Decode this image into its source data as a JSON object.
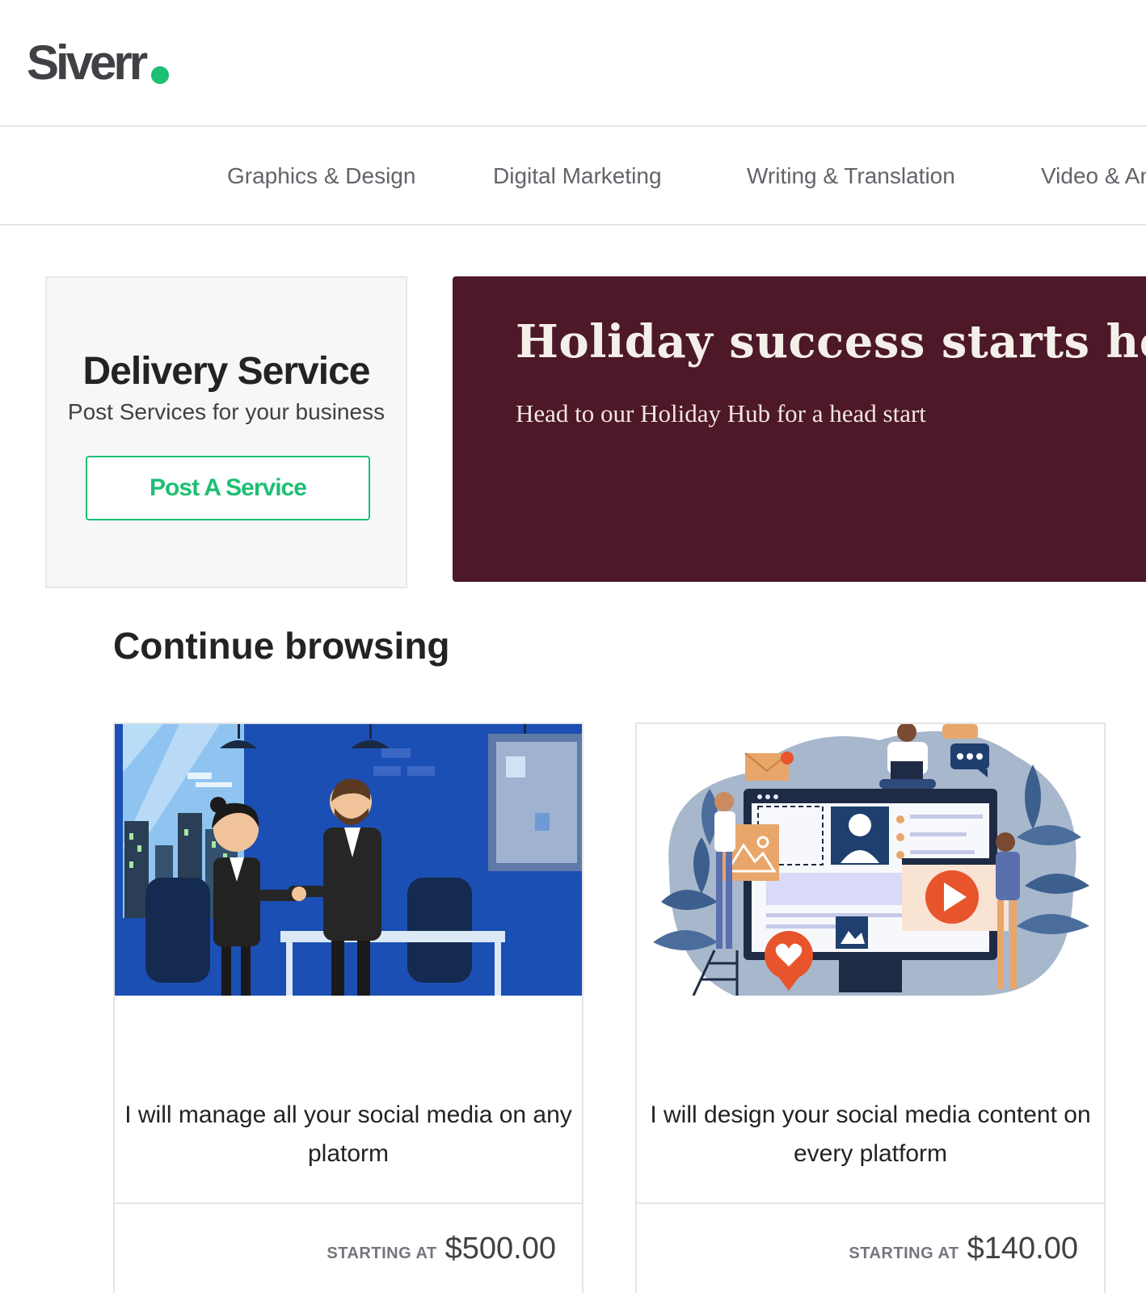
{
  "brand": {
    "name": "Siverr",
    "accent": "#1dbf73"
  },
  "categories": [
    {
      "label": "Graphics & Design"
    },
    {
      "label": "Digital Marketing"
    },
    {
      "label": "Writing & Translation"
    },
    {
      "label": "Video & Animation"
    }
  ],
  "post_card": {
    "title": "Delivery Service",
    "subtitle": "Post Services for your business",
    "button_label": "Post A Service"
  },
  "banner": {
    "title": "Holiday success starts here",
    "subtitle": "Head to our Holiday Hub for a head start",
    "background": "#4d1828"
  },
  "section": {
    "title": "Continue browsing"
  },
  "gigs": [
    {
      "title": "I will manage all your social media on any platorm",
      "price_label": "STARTING AT",
      "price": "$500.00",
      "image_icon": "business-handshake-illustration"
    },
    {
      "title": "I will design your social media content on every platform",
      "price_label": "STARTING AT",
      "price": "$140.00",
      "image_icon": "social-media-design-illustration"
    }
  ]
}
